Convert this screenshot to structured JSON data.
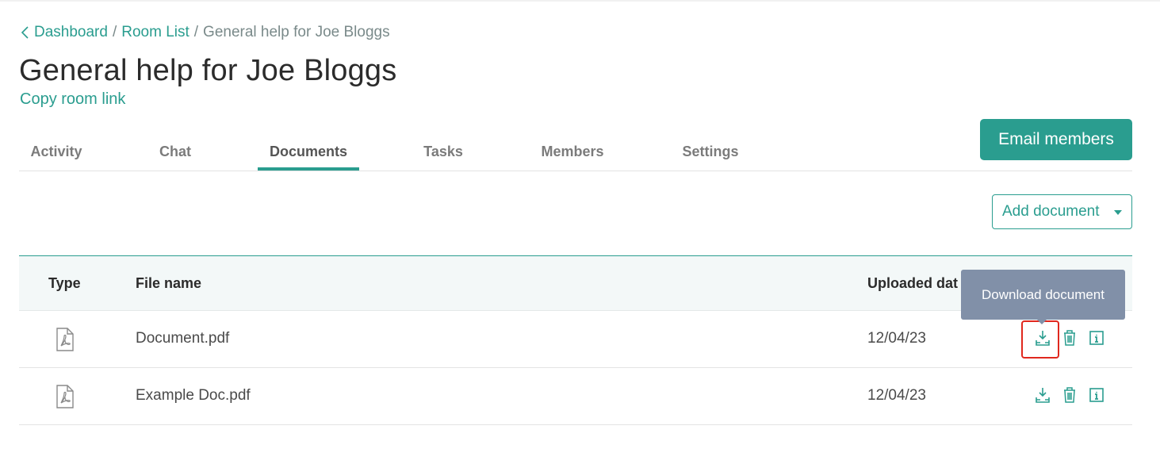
{
  "breadcrumb": {
    "items": [
      {
        "label": "Dashboard"
      },
      {
        "label": "Room List"
      },
      {
        "label": "General help for Joe Bloggs"
      }
    ],
    "separator": "/"
  },
  "page": {
    "title": "General help for Joe Bloggs",
    "copy_link_label": "Copy room link",
    "email_button_label": "Email members"
  },
  "tabs": [
    {
      "label": "Activity"
    },
    {
      "label": "Chat"
    },
    {
      "label": "Documents",
      "active": true
    },
    {
      "label": "Tasks"
    },
    {
      "label": "Members"
    },
    {
      "label": "Settings"
    }
  ],
  "add_document": {
    "label": "Add document"
  },
  "table": {
    "headers": {
      "type": "Type",
      "file_name": "File name",
      "uploaded_date": "Uploaded dat"
    },
    "rows": [
      {
        "type_icon": "pdf-icon",
        "file_name": "Document.pdf",
        "uploaded": "12/04/23"
      },
      {
        "type_icon": "pdf-icon",
        "file_name": "Example Doc.pdf",
        "uploaded": "12/04/23"
      }
    ]
  },
  "tooltip": {
    "text": "Download document"
  },
  "colors": {
    "accent": "#2a9d8f",
    "tooltip_bg": "#8190a8",
    "highlight": "#e0281e",
    "header_bg": "#f3f8f8"
  }
}
